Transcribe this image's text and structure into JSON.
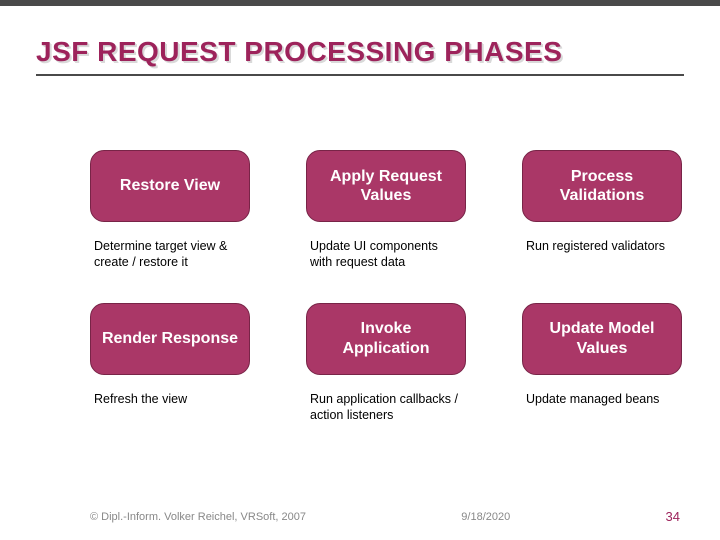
{
  "title": "JSF REQUEST PROCESSING PHASES",
  "phases": {
    "p0": {
      "label": "Restore View",
      "desc": "Determine target view & create / restore it"
    },
    "p1": {
      "label": "Apply Request Values",
      "desc": "Update UI components with request data"
    },
    "p2": {
      "label": "Process Validations",
      "desc": "Run registered validators"
    },
    "p3": {
      "label": "Render Response",
      "desc": "Refresh the view"
    },
    "p4": {
      "label": "Invoke Application",
      "desc": "Run application callbacks / action listeners"
    },
    "p5": {
      "label": "Update Model Values",
      "desc": "Update managed beans"
    }
  },
  "footer": {
    "credit": "© Dipl.-Inform. Volker Reichel, VRSoft, 2007",
    "date": "9/18/2020",
    "page": "34"
  }
}
